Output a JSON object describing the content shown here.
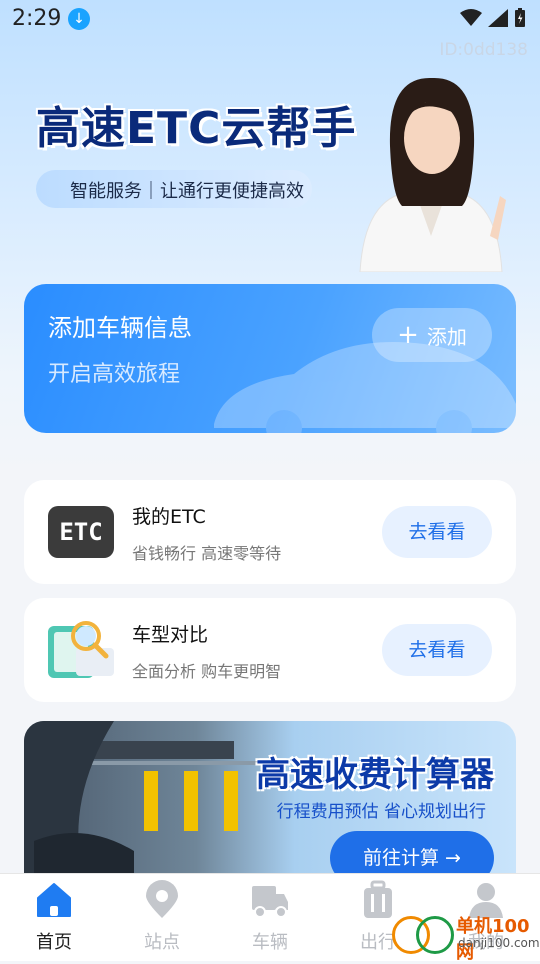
{
  "status_bar": {
    "time": "2:29"
  },
  "watermark": "ID:0dd138",
  "hero": {
    "title": "高速ETC云帮手",
    "subtitle": "智能服务｜让通行更便捷高效"
  },
  "add_card": {
    "title": "添加车辆信息",
    "subtitle": "开启高效旅程",
    "button": "添加"
  },
  "features": [
    {
      "icon": "etc-icon",
      "logo_text": "ETC",
      "title": "我的ETC",
      "subtitle": "省钱畅行 高速零等待",
      "button": "去看看"
    },
    {
      "icon": "car-compare-icon",
      "title": "车型对比",
      "subtitle": "全面分析 购车更明智",
      "button": "去看看"
    }
  ],
  "banner": {
    "title": "高速收费计算器",
    "subtitle": "行程费用预估 省心规划出行",
    "button": "前往计算 →"
  },
  "nav": [
    {
      "label": "首页",
      "icon": "home-icon",
      "active": true
    },
    {
      "label": "站点",
      "icon": "location-icon",
      "active": false
    },
    {
      "label": "车辆",
      "icon": "truck-icon",
      "active": false
    },
    {
      "label": "出行",
      "icon": "luggage-icon",
      "active": false
    },
    {
      "label": "我的",
      "icon": "user-icon",
      "active": false
    }
  ],
  "site_watermark": {
    "name": "单机100网",
    "url": "danji100.com"
  },
  "colors": {
    "primary": "#1f6fe8",
    "hero_title": "#0a2a7a",
    "inactive": "#b9bcc2"
  }
}
